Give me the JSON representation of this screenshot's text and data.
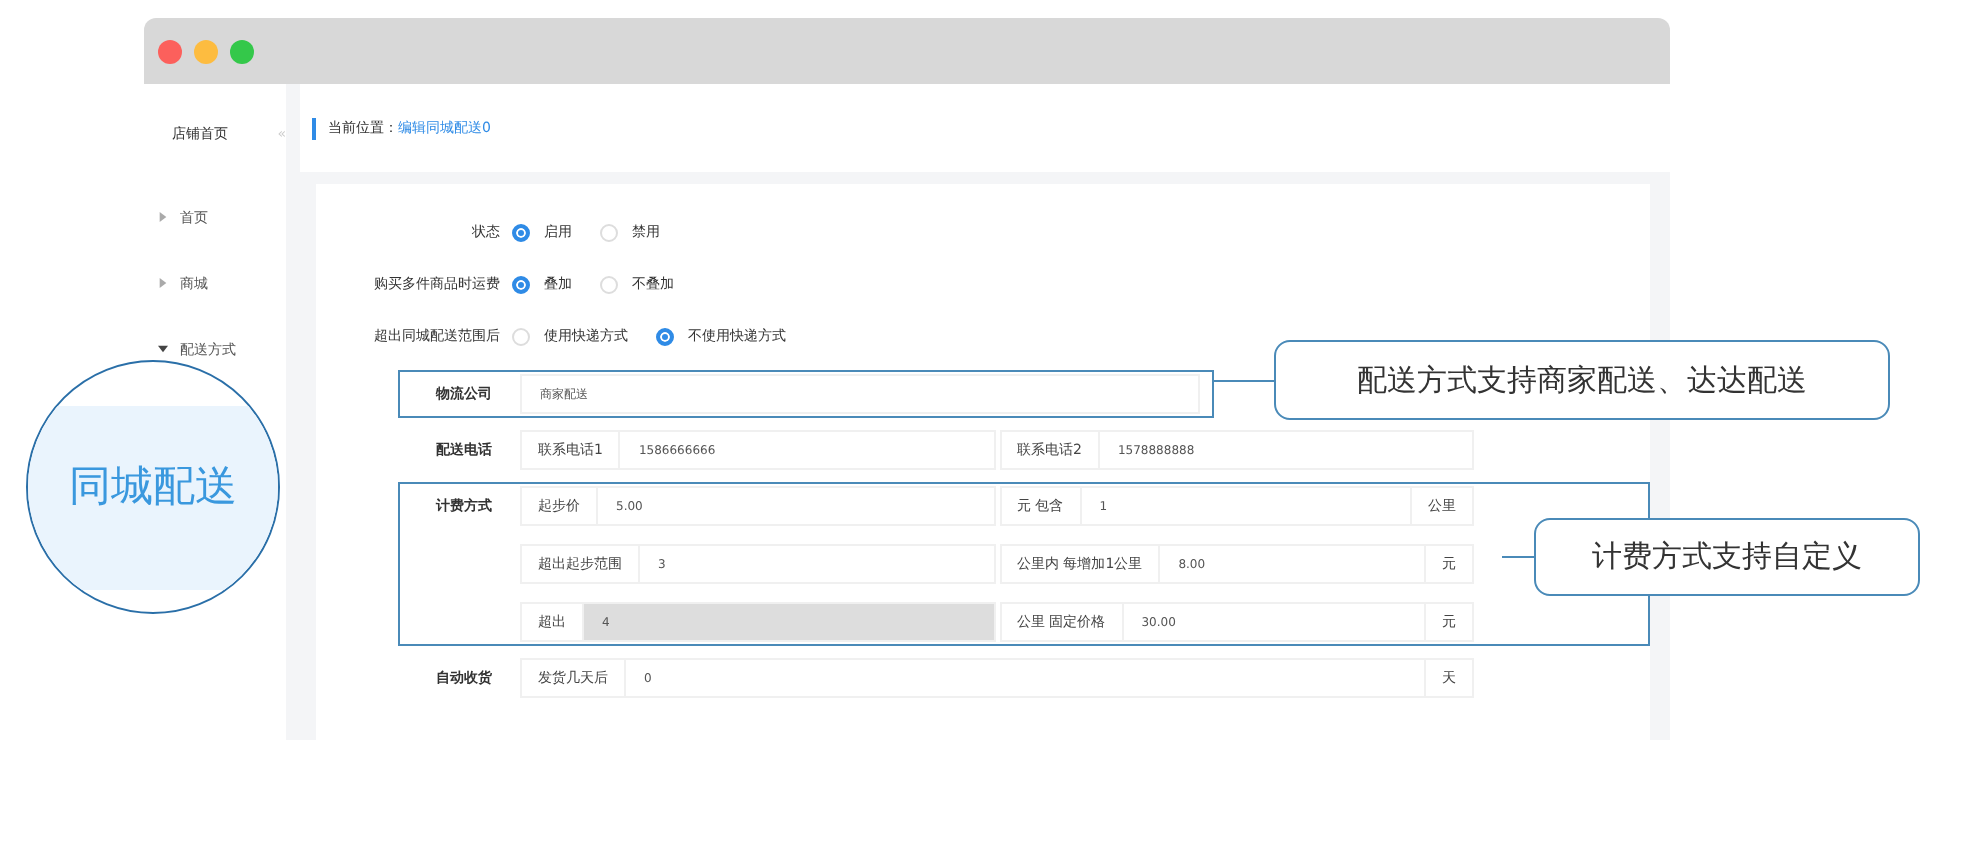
{
  "sidebar": {
    "title": "店铺首页",
    "collapse": "«",
    "items": [
      {
        "label": "首页",
        "expanded": false
      },
      {
        "label": "商城",
        "expanded": false
      },
      {
        "label": "配送方式",
        "expanded": true
      }
    ]
  },
  "breadcrumb": {
    "label": "当前位置：",
    "link": "编辑同城配送0"
  },
  "radio_groups": [
    {
      "label": "状态",
      "options": [
        {
          "label": "启用",
          "selected": true
        },
        {
          "label": "禁用",
          "selected": false
        }
      ]
    },
    {
      "label": "购买多件商品时运费",
      "options": [
        {
          "label": "叠加",
          "selected": true
        },
        {
          "label": "不叠加",
          "selected": false
        }
      ]
    },
    {
      "label": "超出同城配送范围后",
      "options": [
        {
          "label": "使用快递方式",
          "selected": false
        },
        {
          "label": "不使用快递方式",
          "selected": true
        }
      ]
    }
  ],
  "field_rows": [
    {
      "label": "物流公司",
      "kind": "single",
      "highlighted": true,
      "lines": [
        [
          [
            {
              "kind": "input",
              "text": "商家配送"
            }
          ]
        ]
      ]
    },
    {
      "label": "配送电话",
      "kind": "groups",
      "highlighted": false,
      "lines": [
        [
          [
            {
              "kind": "addon",
              "text": "联系电话1"
            },
            {
              "kind": "input",
              "text": "1586666666"
            }
          ],
          [
            {
              "kind": "addon",
              "text": "联系电话2"
            },
            {
              "kind": "input",
              "text": "1578888888"
            }
          ]
        ]
      ]
    },
    {
      "label": "计费方式",
      "kind": "groups",
      "highlighted": true,
      "lines": [
        [
          [
            {
              "kind": "addon",
              "text": "起步价"
            },
            {
              "kind": "input",
              "text": "5.00"
            }
          ],
          [
            {
              "kind": "addon",
              "text": "元 包含"
            },
            {
              "kind": "input",
              "text": "1"
            },
            {
              "kind": "addon",
              "text": "公里"
            }
          ]
        ],
        [
          [
            {
              "kind": "addon",
              "text": "超出起步范围"
            },
            {
              "kind": "input",
              "text": "3"
            }
          ],
          [
            {
              "kind": "addon",
              "text": "公里内 每增加1公里"
            },
            {
              "kind": "input",
              "text": "8.00"
            },
            {
              "kind": "addon",
              "text": "元"
            }
          ]
        ],
        [
          [
            {
              "kind": "addon",
              "text": "超出"
            },
            {
              "kind": "input",
              "text": "4",
              "disabled": true
            }
          ],
          [
            {
              "kind": "addon",
              "text": "公里 固定价格"
            },
            {
              "kind": "input",
              "text": "30.00"
            },
            {
              "kind": "addon",
              "text": "元"
            }
          ]
        ]
      ]
    },
    {
      "label": "自动收货",
      "kind": "groups",
      "highlighted": false,
      "lines": [
        [
          [
            {
              "kind": "addon",
              "text": "发货几天后"
            },
            {
              "kind": "input",
              "text": "0"
            },
            {
              "kind": "addon",
              "text": "天"
            }
          ]
        ]
      ]
    }
  ],
  "callouts": [
    {
      "text": "配送方式支持商家配送、达达配送"
    },
    {
      "text": "计费方式支持自定义"
    }
  ],
  "magnifier": {
    "text": "同城配送"
  }
}
